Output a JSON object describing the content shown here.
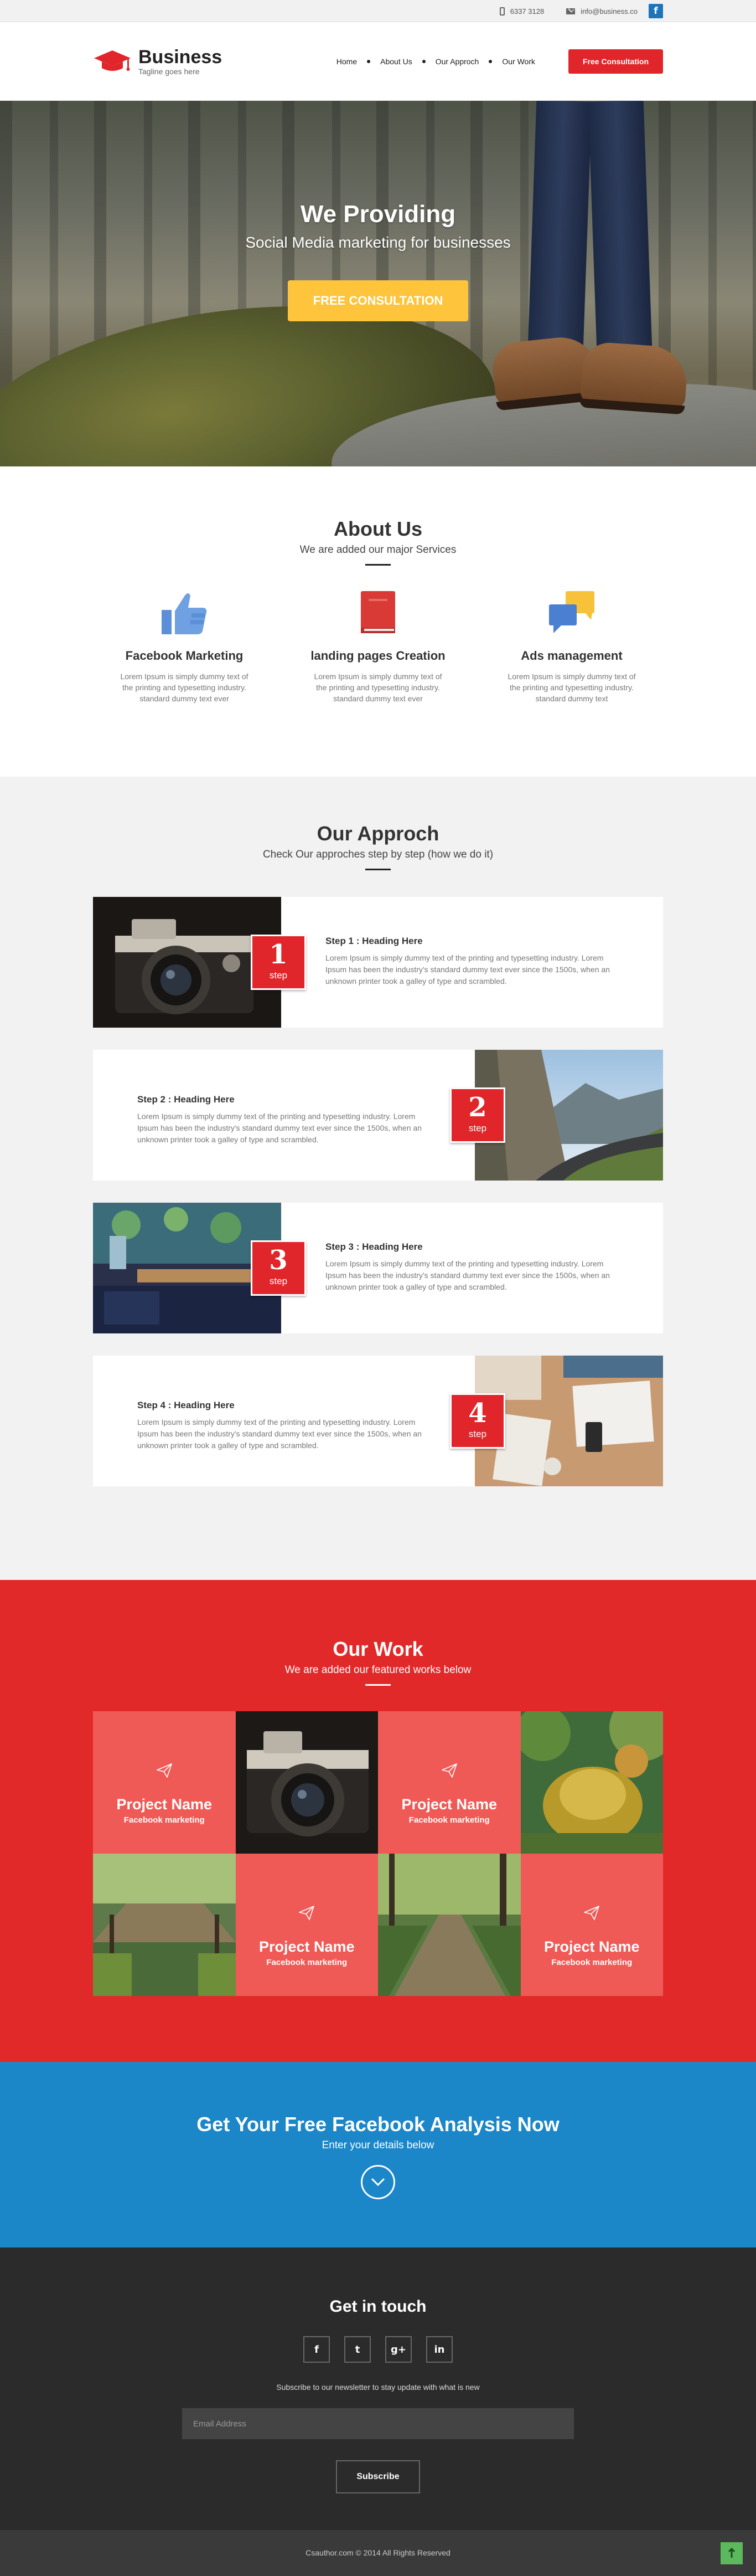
{
  "topbar": {
    "phone": "6337 3128",
    "email": "info@business.co",
    "fb_letter": "f"
  },
  "header": {
    "brand": "Business",
    "tagline": "Tagline goes here",
    "nav": [
      "Home",
      "About Us",
      "Our Approch",
      "Our Work"
    ],
    "cta": "Free Consultation"
  },
  "hero": {
    "title": "We Providing",
    "subtitle": "Social Media marketing for businesses",
    "button": "FREE CONSULTATION"
  },
  "about": {
    "title": "About Us",
    "subtitle": "We are added our major Services",
    "features": [
      {
        "icon": "thumbs-up-icon",
        "title": "Facebook Marketing",
        "text": "Lorem Ipsum is simply dummy text of the printing and typesetting industry. standard dummy text ever"
      },
      {
        "icon": "book-icon",
        "title": "landing pages Creation",
        "text": "Lorem Ipsum is simply dummy text of the printing and typesetting industry. standard dummy text ever"
      },
      {
        "icon": "chat-bubbles-icon",
        "title": "Ads management",
        "text": "Lorem Ipsum is simply dummy text of the printing and typesetting industry. standard dummy text"
      }
    ]
  },
  "approach": {
    "title": "Our Approch",
    "subtitle": "Check Our approches step by step (how we do it)",
    "step_word": "step",
    "steps": [
      {
        "num": "1",
        "heading": "Step 1 : Heading Here",
        "text": "Lorem Ipsum is simply dummy text of the printing and typesetting industry. Lorem Ipsum has been the industry's standard dummy text ever since the 1500s, when an unknown printer took a galley of type and scrambled."
      },
      {
        "num": "2",
        "heading": "Step 2 : Heading Here",
        "text": "Lorem Ipsum is simply dummy text of the printing and typesetting industry. Lorem Ipsum has been the industry's standard dummy text ever since the 1500s, when an unknown printer took a galley of type and scrambled."
      },
      {
        "num": "3",
        "heading": "Step 3 : Heading Here",
        "text": "Lorem Ipsum is simply dummy text of the printing and typesetting industry. Lorem Ipsum has been the industry's standard dummy text ever since the 1500s, when an unknown printer took a galley of type and scrambled."
      },
      {
        "num": "4",
        "heading": "Step 4 : Heading Here",
        "text": "Lorem Ipsum is simply dummy text of the printing and typesetting industry. Lorem Ipsum has been the industry's standard dummy text ever since the 1500s, when an unknown printer took a galley of type and scrambled."
      }
    ]
  },
  "work": {
    "title": "Our Work",
    "subtitle": "We are added our featured works below",
    "project_name": "Project Name",
    "project_category": "Facebook marketing"
  },
  "cta": {
    "title": "Get Your Free Facebook Analysis Now",
    "subtitle": "Enter your details below"
  },
  "contact": {
    "title": "Get in touch",
    "socials": [
      "f",
      "t",
      "g+",
      "in"
    ],
    "note": "Subscribe to our newsletter to stay update with what is new",
    "email_placeholder": "Email Address",
    "subscribe": "Subscribe"
  },
  "footer": {
    "copyright": "Csauthor.com © 2014 All Rights Reserved"
  },
  "colors": {
    "red": "#e0262a",
    "yellow": "#fdc43c",
    "blue": "#1b86c8",
    "dark": "#2b2b2b",
    "coral": "#f05a56"
  }
}
